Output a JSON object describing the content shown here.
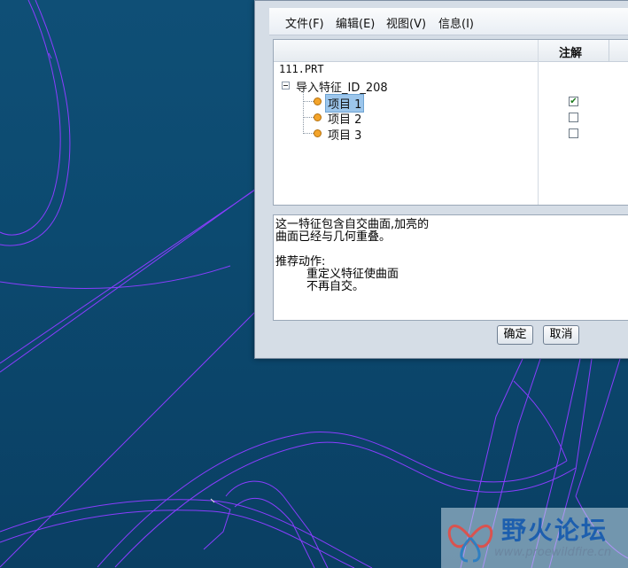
{
  "menubar": {
    "items": [
      {
        "label": "文件(F)"
      },
      {
        "label": "编辑(E)"
      },
      {
        "label": "视图(V)"
      },
      {
        "label": "信息(I)"
      }
    ]
  },
  "tree": {
    "column_header": "注解",
    "root": "111.PRT",
    "feature": "导入特征_ID_208",
    "items": [
      {
        "label": "项目 1",
        "checked": true,
        "selected": true
      },
      {
        "label": "项目 2",
        "checked": false,
        "selected": false
      },
      {
        "label": "项目 3",
        "checked": false,
        "selected": false
      }
    ]
  },
  "message": {
    "lines": [
      "这一特征包含自交曲面,加亮的",
      "曲面已经与几何重叠。",
      "",
      "推荐动作:",
      "重定义特征使曲面",
      "不再自交。"
    ]
  },
  "buttons": {
    "ok": "确定",
    "cancel": "取消"
  },
  "watermark": {
    "title": "野火论坛",
    "url": "www.proewildfire.cn"
  },
  "colors": {
    "background": "#0c4a70",
    "wireframe": "#7a3cff",
    "selection": "#9cc6ec"
  }
}
